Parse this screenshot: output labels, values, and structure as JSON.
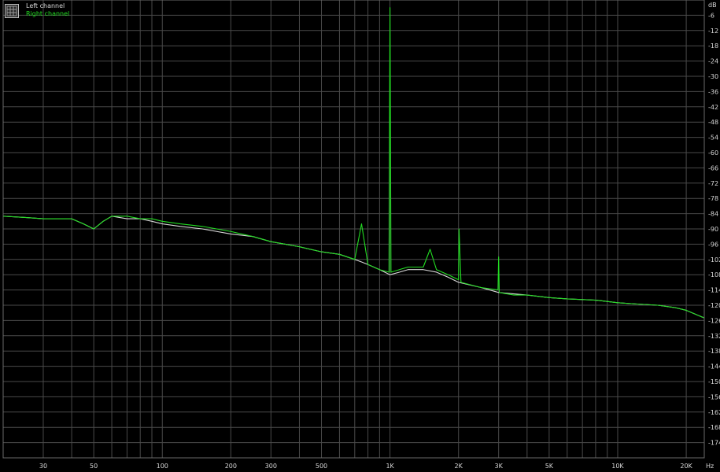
{
  "chart_data": {
    "type": "line",
    "x_scale": "log",
    "xlim": [
      20,
      24000
    ],
    "ylim": [
      -180,
      0
    ],
    "x_unit": "Hz",
    "y_unit": "dB",
    "grid": true,
    "legend_position": "top-left",
    "x_ticks": [
      {
        "value": 30,
        "label": "30"
      },
      {
        "value": 50,
        "label": "50"
      },
      {
        "value": 100,
        "label": "100"
      },
      {
        "value": 200,
        "label": "200"
      },
      {
        "value": 300,
        "label": "300"
      },
      {
        "value": 500,
        "label": "500"
      },
      {
        "value": 1000,
        "label": "1K"
      },
      {
        "value": 2000,
        "label": "2K"
      },
      {
        "value": 3000,
        "label": "3K"
      },
      {
        "value": 5000,
        "label": "5K"
      },
      {
        "value": 10000,
        "label": "10K"
      },
      {
        "value": 20000,
        "label": "20K"
      }
    ],
    "y_ticks": [
      -6,
      -12,
      -18,
      -24,
      -30,
      -36,
      -42,
      -48,
      -54,
      -60,
      -66,
      -72,
      -78,
      -84,
      -90,
      -96,
      -102,
      -108,
      -114,
      -120,
      -126,
      -132,
      -138,
      -144,
      -150,
      -156,
      -162,
      -168,
      -174
    ],
    "series": [
      {
        "name": "Left channel",
        "color": "#d8d8d8",
        "x": [
          20,
          25,
          30,
          35,
          40,
          45,
          50,
          55,
          60,
          70,
          80,
          90,
          100,
          120,
          150,
          200,
          250,
          300,
          400,
          500,
          600,
          700,
          750,
          800,
          900,
          1000,
          1100,
          1200,
          1400,
          1600,
          1800,
          2000,
          2500,
          3000,
          4000,
          5000,
          6000,
          8000,
          10000,
          12000,
          15000,
          18000,
          20000,
          24000
        ],
        "y": [
          -85,
          -85.5,
          -86,
          -86,
          -86,
          -88,
          -90,
          -87,
          -85,
          -86,
          -86,
          -87,
          -88,
          -89,
          -90,
          -92,
          -93,
          -95,
          -97,
          -99,
          -100,
          -102,
          -103,
          -104,
          -106,
          -108,
          -107,
          -106,
          -106,
          -107,
          -109,
          -111,
          -113,
          -115,
          -116,
          -117,
          -117.5,
          -118,
          -119,
          -119.5,
          -120,
          -121,
          -122,
          -125
        ]
      },
      {
        "name": "Right channel",
        "color": "#22dd22",
        "x": [
          20,
          25,
          30,
          35,
          40,
          45,
          50,
          55,
          60,
          70,
          80,
          90,
          100,
          120,
          150,
          200,
          250,
          300,
          400,
          500,
          600,
          700,
          750,
          800,
          900,
          990,
          1000,
          1010,
          1100,
          1200,
          1400,
          1500,
          1600,
          1800,
          2000,
          2010,
          2050,
          2500,
          2980,
          3000,
          3020,
          3500,
          4000,
          5000,
          6000,
          8000,
          10000,
          12000,
          15000,
          18000,
          20000,
          24000
        ],
        "y": [
          -85,
          -85.5,
          -86,
          -86,
          -86,
          -88,
          -90,
          -87,
          -85,
          -85,
          -86,
          -86,
          -87,
          -88,
          -89,
          -91,
          -93,
          -95,
          -97,
          -99,
          -100,
          -102,
          -88,
          -104,
          -106,
          -107,
          -3,
          -107,
          -106,
          -105,
          -105,
          -98,
          -106,
          -108,
          -110,
          -90,
          -111,
          -113,
          -114,
          -101,
          -115,
          -116,
          -116,
          -117,
          -117.5,
          -118,
          -119,
          -119.5,
          -120,
          -121,
          -122,
          -125
        ]
      }
    ]
  }
}
